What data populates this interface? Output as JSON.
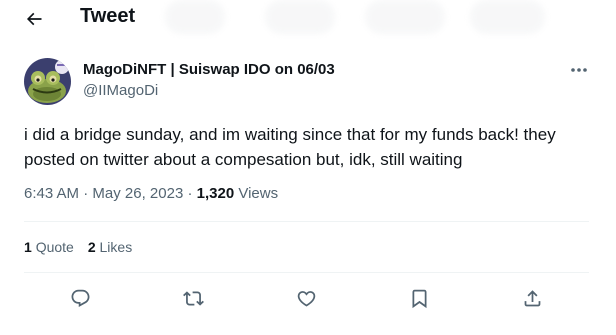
{
  "header": {
    "title": "Tweet",
    "back_icon": "arrow-left-icon"
  },
  "author": {
    "name": "MagoDiNFT | Suiswap IDO on 06/03",
    "handle": "@IIMagoDi",
    "avatar_icon": "frog-avatar"
  },
  "tweet": {
    "text": "i did a bridge sunday, and im waiting since that for my funds back! they posted on twitter about a compesation but, idk, still waiting",
    "time": "6:43 AM",
    "separator": "·",
    "date": "May 26, 2023",
    "views_count": "1,320",
    "views_label": "Views"
  },
  "stats": {
    "quotes_count": "1",
    "quotes_label": "Quote",
    "likes_count": "2",
    "likes_label": "Likes"
  },
  "actions": {
    "icons": [
      "reply-icon",
      "retweet-icon",
      "like-icon",
      "bookmark-icon",
      "share-icon"
    ]
  },
  "colors": {
    "text": "#0f1419",
    "muted": "#536471",
    "divider": "#eff3f4"
  }
}
